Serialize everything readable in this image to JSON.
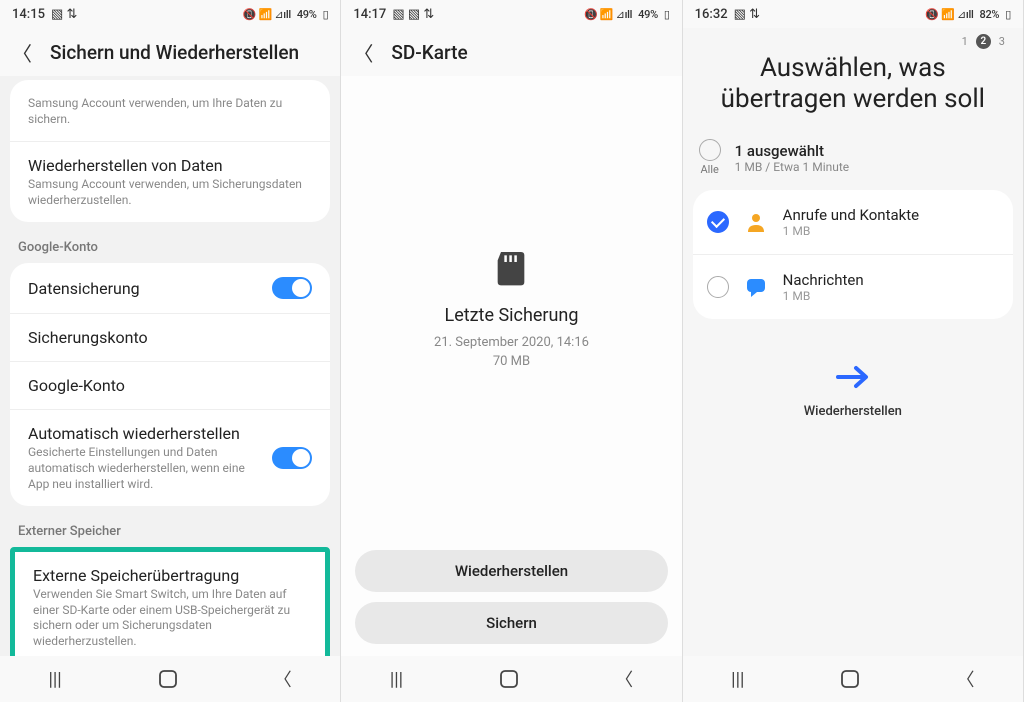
{
  "phone1": {
    "status": {
      "time": "14:15",
      "battery": "49%",
      "icons_left": "▧ ⇅",
      "icons_right": "📵 📶 ⊿ıll"
    },
    "header": {
      "title": "Sichern und Wiederherstellen"
    },
    "top_card": {
      "item1_sub": "Samsung Account verwenden, um Ihre Daten zu sichern.",
      "item2_title": "Wiederherstellen von Daten",
      "item2_sub": "Samsung Account verwenden, um Sicherungsdaten wiederherzustellen."
    },
    "section_google": "Google-Konto",
    "google_card": {
      "r1": "Datensicherung",
      "r2": "Sicherungskonto",
      "r3": "Google-Konto",
      "r4_title": "Automatisch wiederherstellen",
      "r4_sub": "Gesicherte Einstellungen und Daten automatisch wiederherstellen, wenn eine App neu installiert wird."
    },
    "section_ext": "Externer Speicher",
    "ext_card": {
      "title": "Externe Speicherübertragung",
      "sub": "Verwenden Sie Smart Switch, um Ihre Daten auf einer SD-Karte oder einem USB-Speichergerät zu sichern oder um Sicherungsdaten wiederherzustellen."
    }
  },
  "phone2": {
    "status": {
      "time": "14:17",
      "battery": "49%",
      "icons_left": "▧ ▧ ⇅",
      "icons_right": "📵 📶 ⊿ıll"
    },
    "header": {
      "title": "SD-Karte"
    },
    "center": {
      "title": "Letzte Sicherung",
      "date": "21. September 2020, 14:16",
      "size": "70 MB"
    },
    "btn_restore": "Wiederherstellen",
    "btn_backup": "Sichern"
  },
  "phone3": {
    "status": {
      "time": "16:32",
      "battery": "82%",
      "icons_left": "▧ ⇅",
      "icons_right": "📵 📶 ⊿ıll"
    },
    "steps": {
      "s1": "1",
      "s2": "2",
      "s3": "3"
    },
    "title": "Auswählen, was übertragen werden soll",
    "select_all": {
      "label": "Alle",
      "title": "1 ausgewählt",
      "sub": "1 MB / Etwa 1 Minute"
    },
    "items": [
      {
        "title": "Anrufe und Kontakte",
        "sub": "1 MB",
        "checked": true,
        "color": "#f5a623",
        "icon": "person"
      },
      {
        "title": "Nachrichten",
        "sub": "1 MB",
        "checked": false,
        "color": "#2b8cff",
        "icon": "chat"
      }
    ],
    "restore": "Wiederherstellen"
  }
}
